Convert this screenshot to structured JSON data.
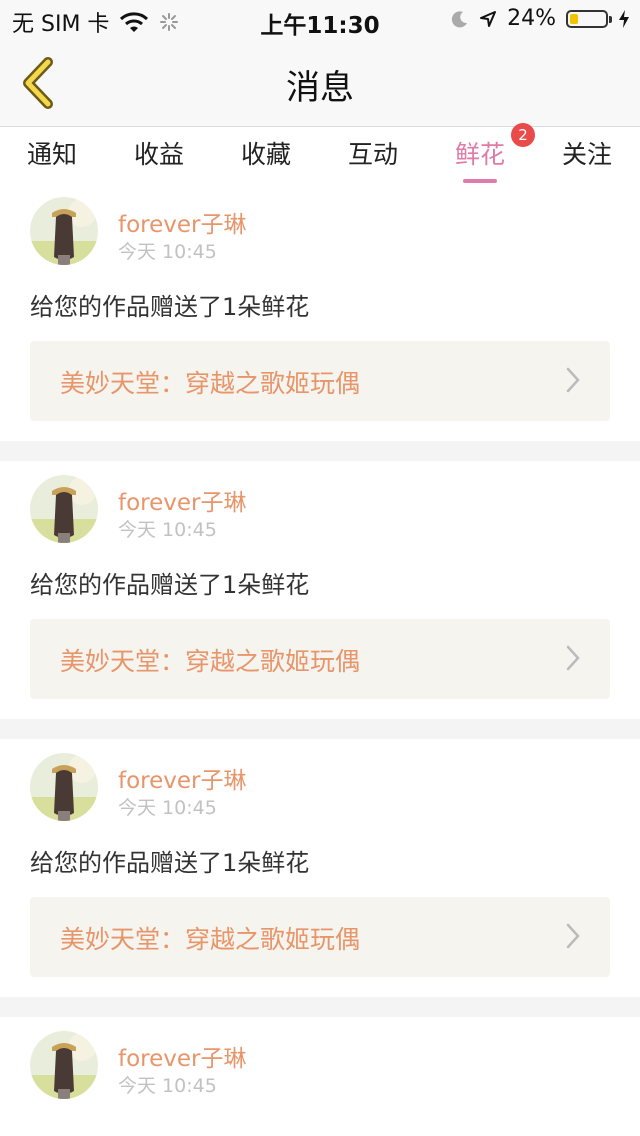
{
  "status_bar": {
    "carrier": "无 SIM 卡",
    "time": "上午11:30",
    "battery": "24%",
    "battery_level": 0.24
  },
  "header": {
    "title": "消息"
  },
  "tabs": [
    {
      "label": "通知"
    },
    {
      "label": "收益"
    },
    {
      "label": "收藏"
    },
    {
      "label": "互动"
    },
    {
      "label": "鲜花",
      "active": true,
      "badge": "2"
    },
    {
      "label": "关注"
    }
  ],
  "messages": [
    {
      "user": "forever子琳",
      "time": "今天 10:45",
      "text": "给您的作品赠送了1朵鲜花",
      "work": "美妙天堂：穿越之歌姬玩偶"
    },
    {
      "user": "forever子琳",
      "time": "今天 10:45",
      "text": "给您的作品赠送了1朵鲜花",
      "work": "美妙天堂：穿越之歌姬玩偶"
    },
    {
      "user": "forever子琳",
      "time": "今天 10:45",
      "text": "给您的作品赠送了1朵鲜花",
      "work": "美妙天堂：穿越之歌姬玩偶"
    },
    {
      "user": "forever子琳",
      "time": "今天 10:45"
    }
  ],
  "colors": {
    "accent": "#e07aa8",
    "username": "#e8956a",
    "badge": "#e94a4a"
  }
}
